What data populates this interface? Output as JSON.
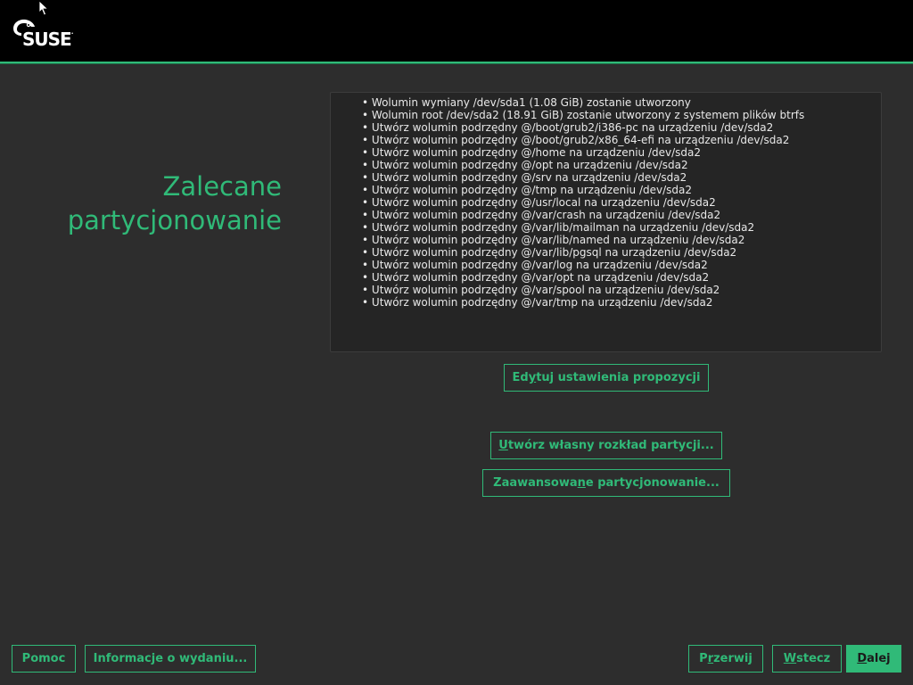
{
  "header": {
    "logo_text": "SUSE",
    "logo_tm": ".",
    "brand_color": "#30ba78"
  },
  "page": {
    "title_line1": "Zalecane",
    "title_line2": "partycjonowanie"
  },
  "proposal": {
    "items": [
      "Wolumin wymiany /dev/sda1 (1.08 GiB) zostanie utworzony",
      "Wolumin root /dev/sda2 (18.91 GiB) zostanie utworzony z systemem plików btrfs",
      "Utwórz wolumin podrzędny @/boot/grub2/i386-pc na urządzeniu /dev/sda2",
      "Utwórz wolumin podrzędny @/boot/grub2/x86_64-efi na urządzeniu /dev/sda2",
      "Utwórz wolumin podrzędny @/home na urządzeniu /dev/sda2",
      "Utwórz wolumin podrzędny @/opt na urządzeniu /dev/sda2",
      "Utwórz wolumin podrzędny @/srv na urządzeniu /dev/sda2",
      "Utwórz wolumin podrzędny @/tmp na urządzeniu /dev/sda2",
      "Utwórz wolumin podrzędny @/usr/local na urządzeniu /dev/sda2",
      "Utwórz wolumin podrzędny @/var/crash na urządzeniu /dev/sda2",
      "Utwórz wolumin podrzędny @/var/lib/mailman na urządzeniu /dev/sda2",
      "Utwórz wolumin podrzędny @/var/lib/named na urządzeniu /dev/sda2",
      "Utwórz wolumin podrzędny @/var/lib/pgsql na urządzeniu /dev/sda2",
      "Utwórz wolumin podrzędny @/var/log na urządzeniu /dev/sda2",
      "Utwórz wolumin podrzędny @/var/opt na urządzeniu /dev/sda2",
      "Utwórz wolumin podrzędny @/var/spool na urządzeniu /dev/sda2",
      "Utwórz wolumin podrzędny @/var/tmp na urządzeniu /dev/sda2"
    ]
  },
  "actions": {
    "edit_proposal": {
      "pre": "Ed",
      "key": "y",
      "post": "tuj ustawienia propozycji"
    },
    "create_layout": {
      "pre": "",
      "key": "U",
      "post": "twórz własny rozkład partycji..."
    },
    "advanced": {
      "pre": "Zaawansowa",
      "key": "n",
      "post": "e partycjonowanie..."
    }
  },
  "footer": {
    "help": "Pomoc",
    "release_notes": "Informacje o wydaniu...",
    "abort": {
      "pre": "P",
      "key": "r",
      "post": "zerwij"
    },
    "back": {
      "pre": "",
      "key": "W",
      "post": "stecz"
    },
    "next": {
      "pre": "",
      "key": "D",
      "post": "alej"
    }
  }
}
